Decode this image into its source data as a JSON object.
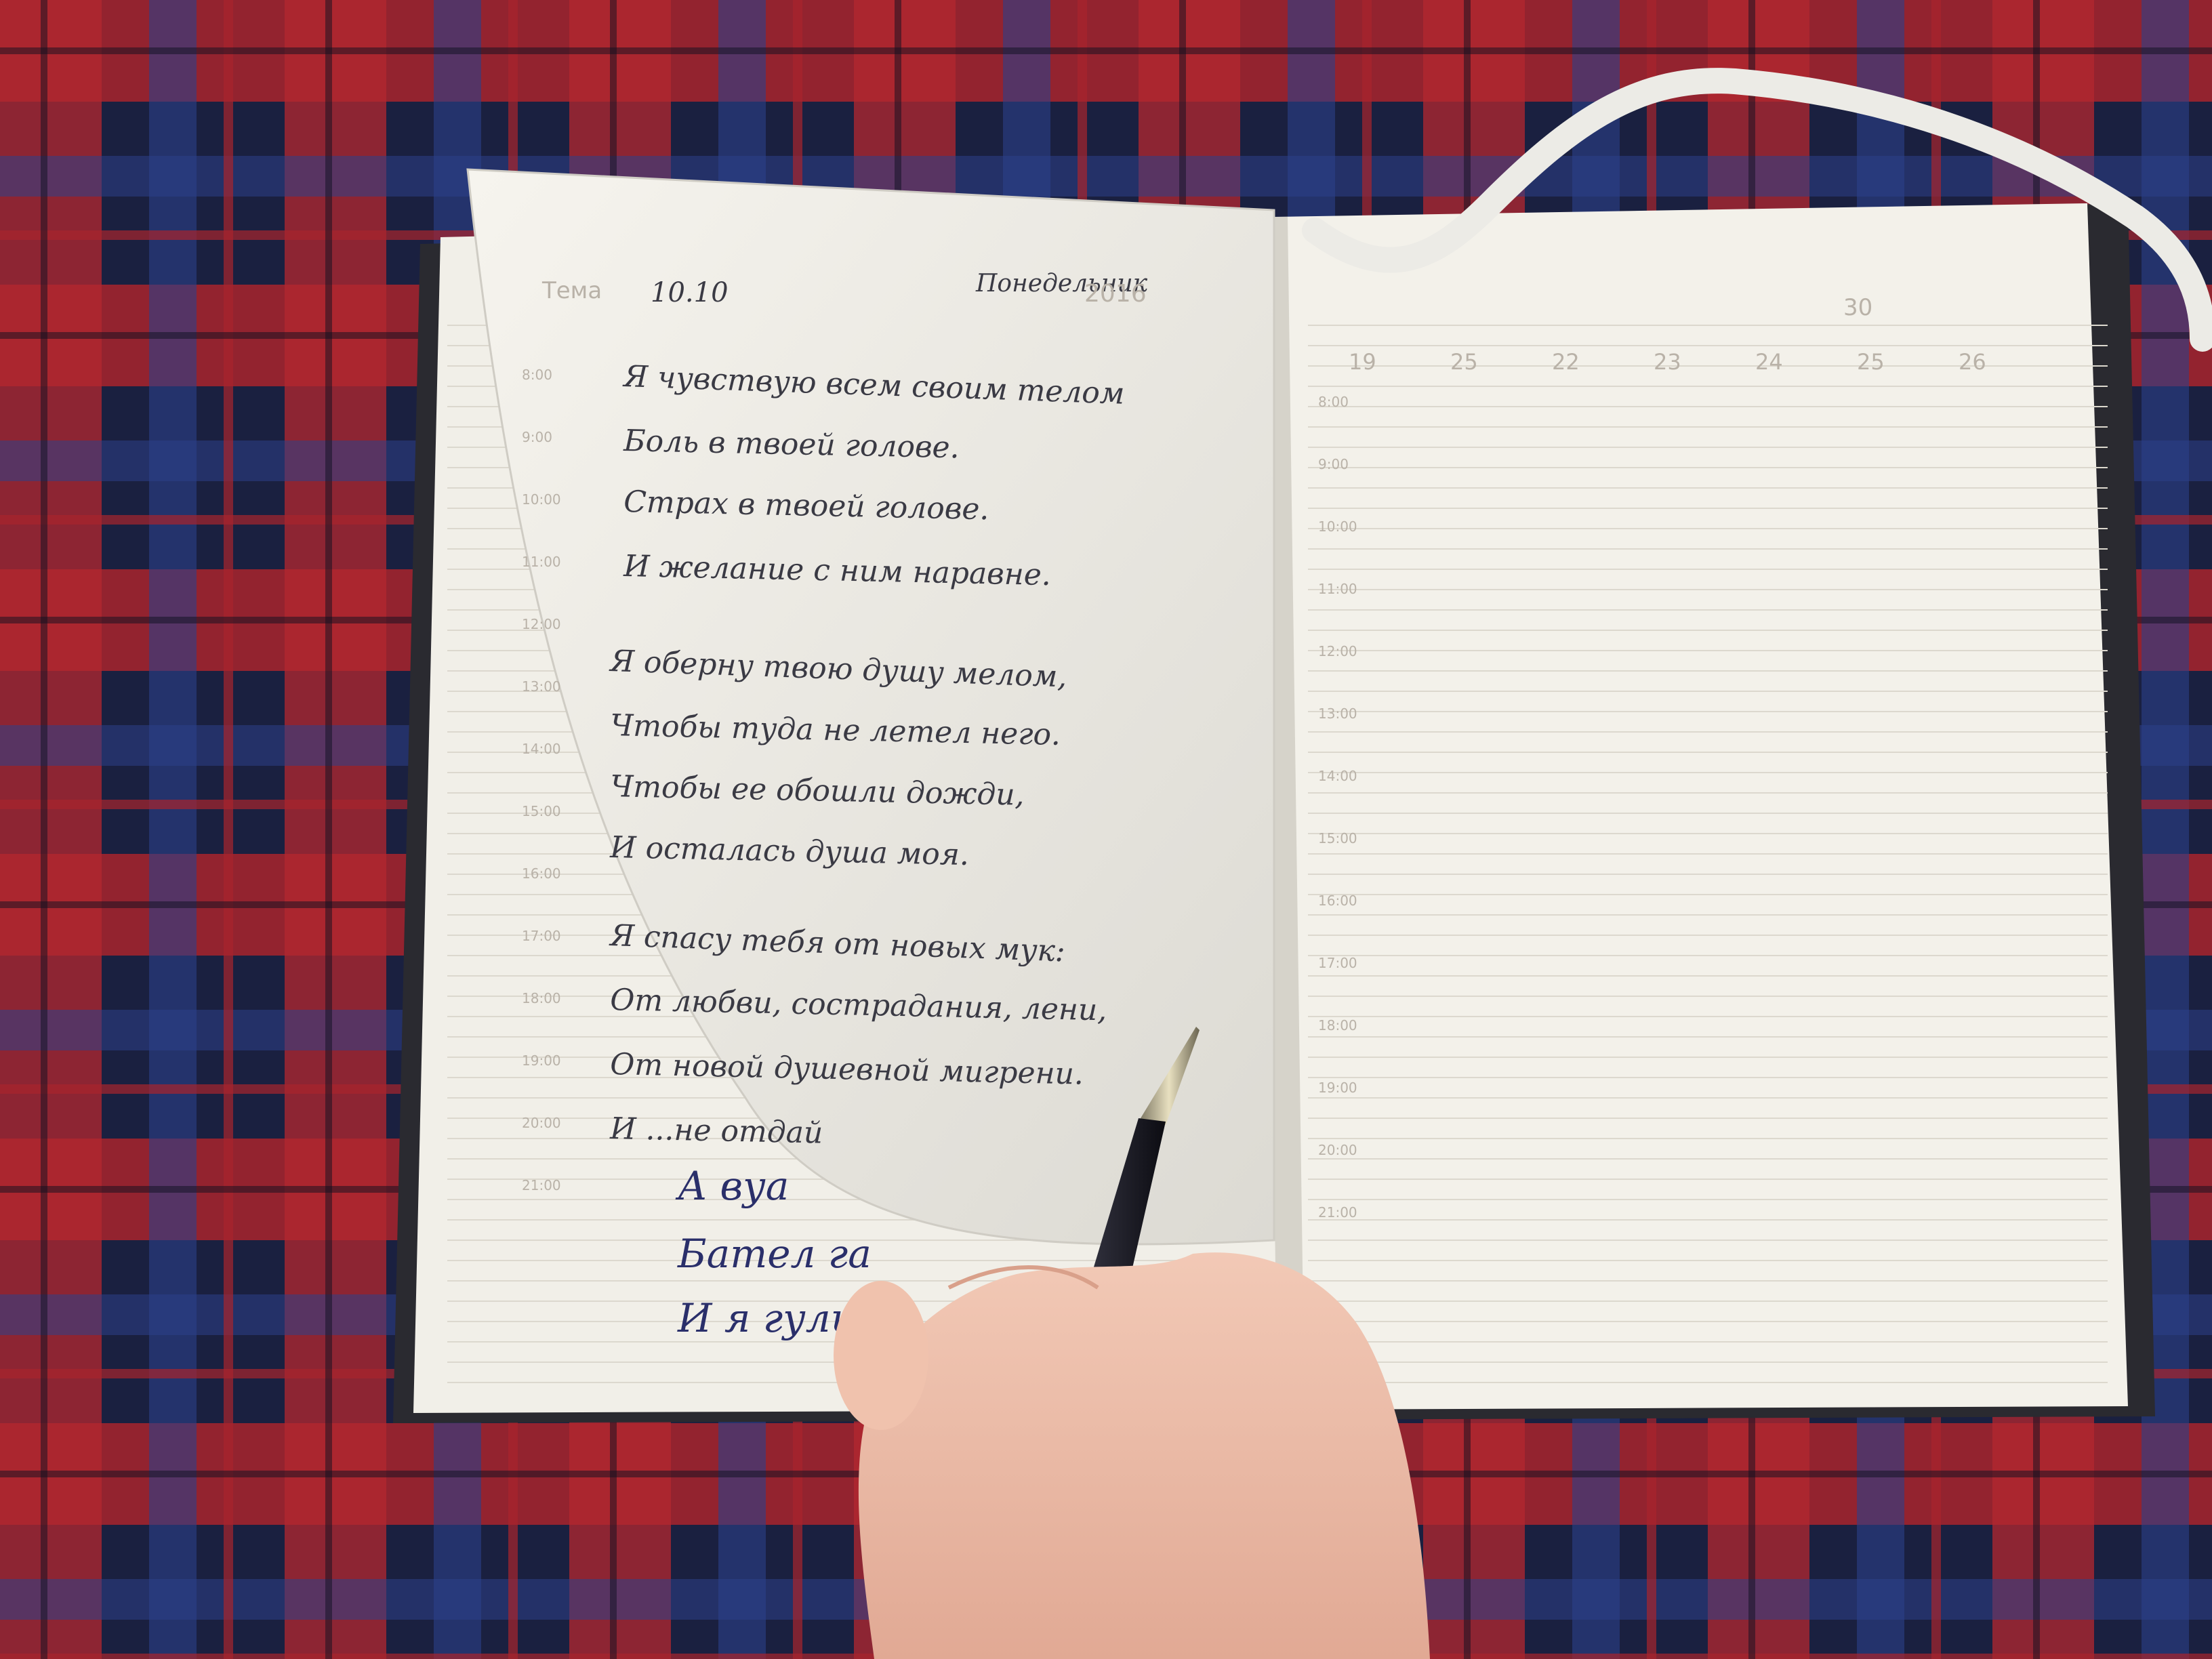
{
  "photo": {
    "subject": "open notebook on plaid blanket with hand holding pen",
    "colors": {
      "plaid_red": "#b3262e",
      "plaid_navy": "#1a2040",
      "plaid_blue": "#2c3f88",
      "paper": "#f1efe8",
      "ink": "#3a3a44",
      "ribbon": "#ecebe6"
    }
  },
  "left_page": {
    "header": [
      "Тема",
      "10.10",
      "Понедельник",
      "2016"
    ],
    "poem": [
      "Я чувствую всем своим телом",
      "Боль в твоей голове.",
      "Страх в твоей голове.",
      "И желание с ним наравне.",
      "Я оберну твою душу мелом,",
      "Чтобы туда не летел него.",
      "Чтобы ее обошли дожди,",
      "И осталась душа моя.",
      "Я спасу тебя от новых мук:",
      "От любви, сострадания, лени,",
      "От новой душевной мигрени.",
      "И ...не отдай"
    ],
    "under_page": [
      "А вуа",
      "Бател га",
      "И я гуль"
    ],
    "hours": [
      "8:00",
      "9:00",
      "10:00",
      "11:00",
      "12:00",
      "13:00",
      "14:00",
      "15:00",
      "16:00",
      "17:00",
      "18:00",
      "19:00",
      "20:00",
      "21:00"
    ]
  },
  "right_page": {
    "header_number": "30",
    "days": [
      "19",
      "25",
      "22",
      "23",
      "24",
      "25",
      "26"
    ],
    "hours": [
      "8:00",
      "9:00",
      "10:00",
      "11:00",
      "12:00",
      "13:00",
      "14:00",
      "15:00",
      "16:00",
      "17:00",
      "18:00",
      "19:00",
      "20:00",
      "21:00"
    ]
  }
}
